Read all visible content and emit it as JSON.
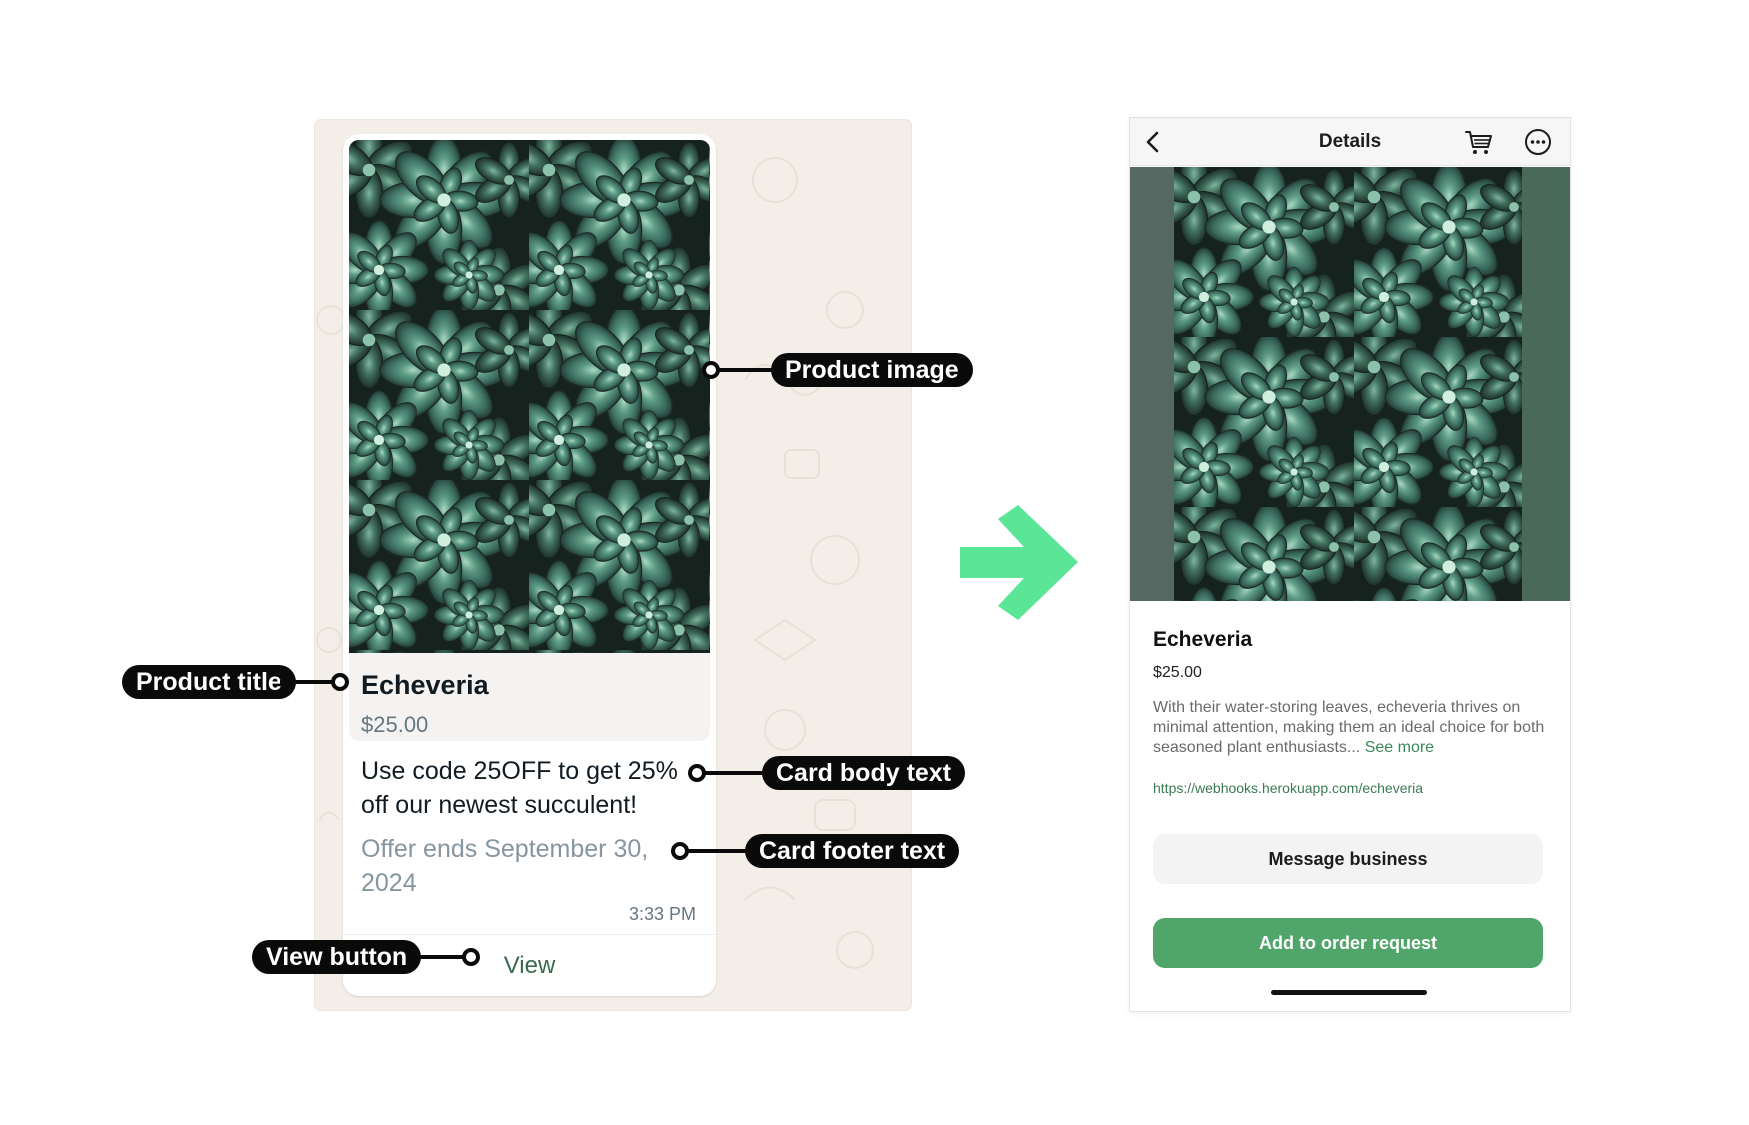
{
  "colors": {
    "chat_background": "#f3efe8",
    "accent_green": "#4fa56a",
    "arrow_green": "#5be596",
    "callout_black": "#0a0a0a"
  },
  "chat_card": {
    "image_alt": "Echeveria succulents",
    "title": "Echeveria",
    "price": "$25.00",
    "body": "Use code 25OFF to get 25% off our newest succulent!",
    "footer": "Offer ends September 30, 2024",
    "time": "3:33 PM",
    "view_button": "View"
  },
  "callouts": {
    "product_image": "Product image",
    "product_title": "Product title",
    "card_body": "Card body text",
    "card_footer": "Card footer text",
    "view_button": "View button"
  },
  "details": {
    "topbar_title": "Details",
    "icons": [
      "back-icon",
      "cart-icon",
      "more-icon"
    ],
    "title": "Echeveria",
    "price": "$25.00",
    "description": "With their water-storing leaves, echeveria thrives on minimal attention, making them an ideal choice for both seasoned plant enthusiasts...",
    "see_more": "See more",
    "url": "https://webhooks.herokuapp.com/echeveria",
    "message_button": "Message business",
    "order_button": "Add to order request"
  }
}
